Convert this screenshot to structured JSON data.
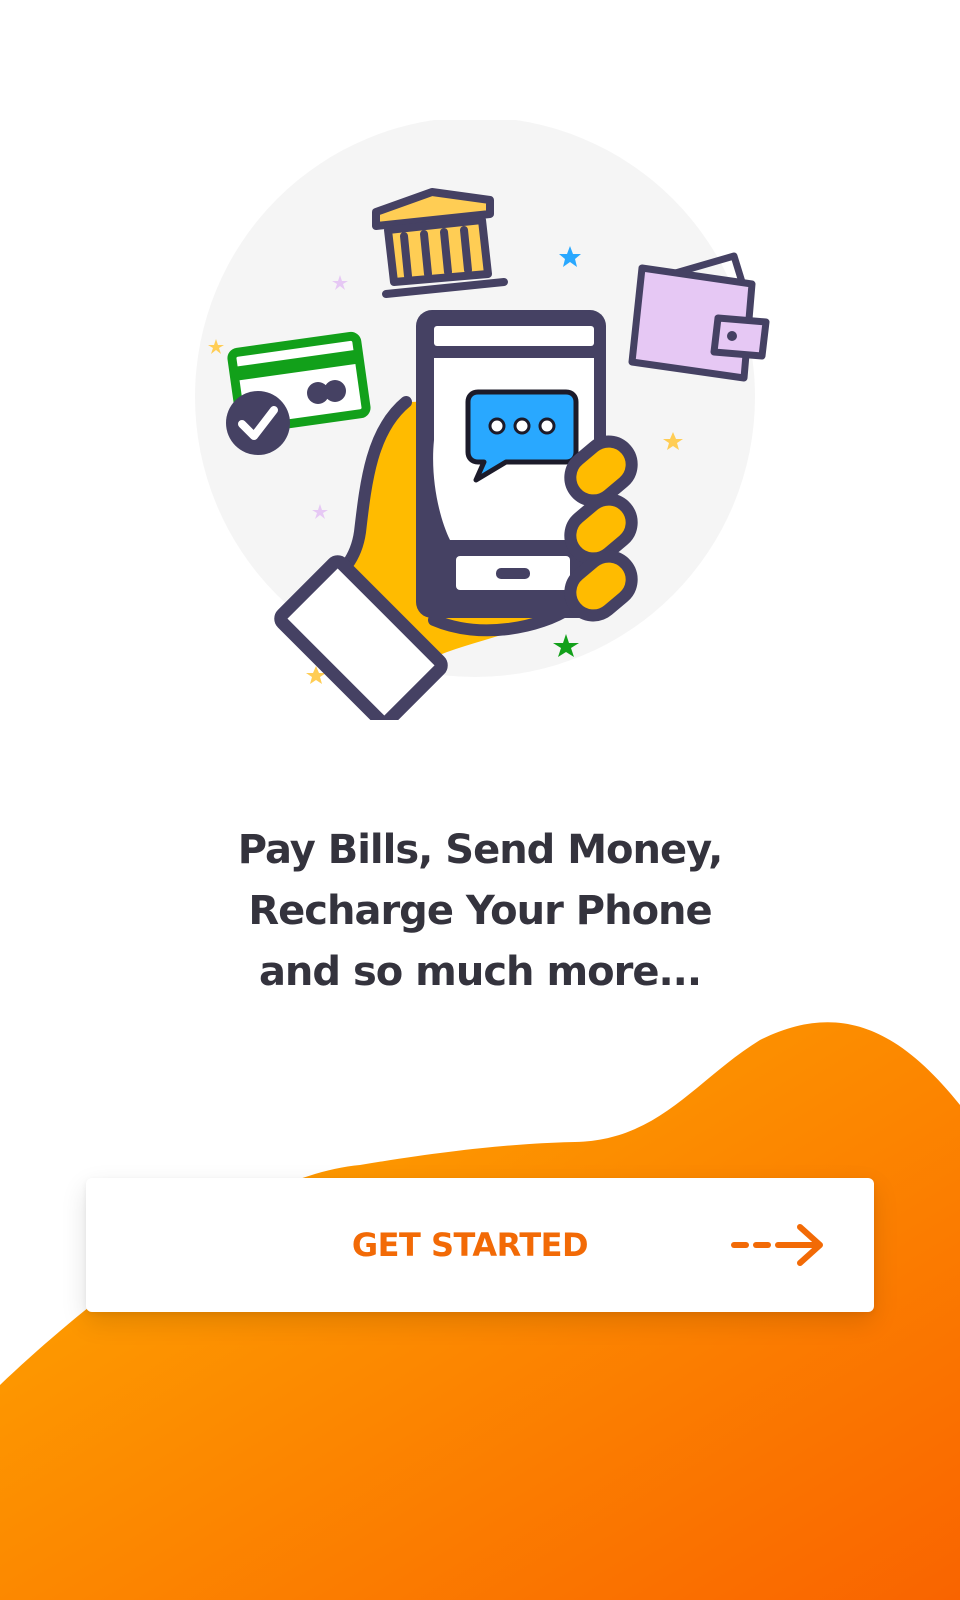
{
  "onboarding": {
    "tagline_lines": [
      "Pay Bills, Send Money,",
      "Recharge Your Phone",
      "and so much more..."
    ],
    "cta_label": "GET STARTED"
  },
  "illustration": {
    "subject": "hand holding phone with bank, credit card and wallet icons",
    "icons": [
      "bank-icon",
      "credit-card-icon",
      "checkmark-icon",
      "wallet-icon",
      "chat-bubble-icon",
      "star-icon"
    ]
  },
  "colors": {
    "background": "#ffffff",
    "text_primary": "#34333d",
    "accent_orange": "#f26a06",
    "gradient_start": "#ffad00",
    "gradient_end": "#f96400",
    "illustration_outline": "#454163",
    "illustration_yellow": "#ffbb00",
    "illustration_green": "#12a01a",
    "illustration_blue": "#29a8ff",
    "illustration_lilac": "#e6c8f4",
    "circle_bg": "#f5f5f5"
  },
  "icons": {
    "cta_arrow": "arrow-right-icon"
  }
}
